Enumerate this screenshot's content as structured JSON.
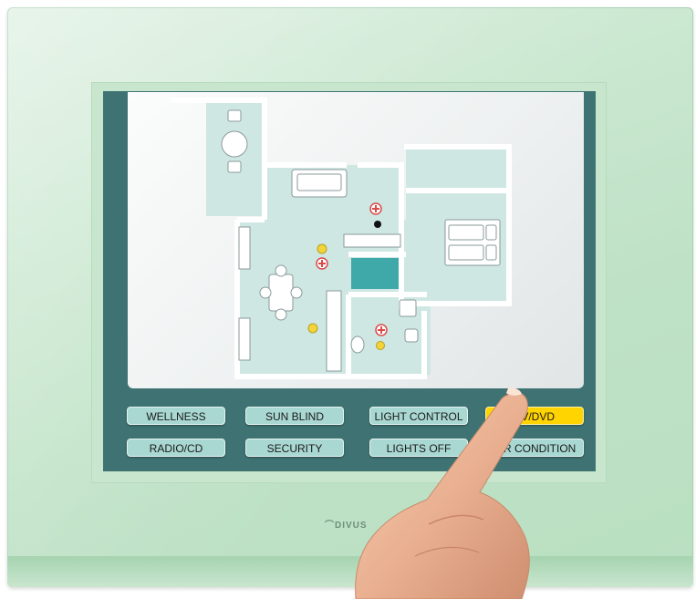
{
  "brand": {
    "logo_text": "DIVUS"
  },
  "controls": {
    "row1": [
      {
        "id": "wellness",
        "label": "WELLNESS",
        "active": false
      },
      {
        "id": "sun-blind",
        "label": "SUN BLIND",
        "active": false
      },
      {
        "id": "light-control",
        "label": "LIGHT CONTROL",
        "active": false
      },
      {
        "id": "tv-dvd",
        "label": "TV/DVD",
        "active": true
      }
    ],
    "row2": [
      {
        "id": "radio-cd",
        "label": "RADIO/CD",
        "active": false
      },
      {
        "id": "security",
        "label": "SECURITY",
        "active": false
      },
      {
        "id": "lights-off",
        "label": "LIGHTS OFF",
        "active": false
      },
      {
        "id": "air-condition",
        "label": "AIR CONDITION",
        "active": false
      }
    ]
  },
  "colors": {
    "frame": "#3f7373",
    "button": "#a9d8d2",
    "button_active": "#ffd400",
    "room_fill": "#cfe7e3",
    "wall": "#ffffff",
    "pool": "#3fa8a8",
    "light_indicator": "#f2d43a",
    "heating_indicator": "#d94a4a"
  },
  "floorplan": {
    "rooms": [
      "balcony",
      "living-room",
      "bedroom",
      "bathroom",
      "pool"
    ],
    "indicators": [
      {
        "type": "heating",
        "room": "hall"
      },
      {
        "type": "sensor",
        "room": "hall"
      },
      {
        "type": "light",
        "room": "living-room"
      },
      {
        "type": "heating",
        "room": "living-room"
      },
      {
        "type": "light",
        "room": "living-room"
      },
      {
        "type": "heating",
        "room": "bathroom"
      },
      {
        "type": "light",
        "room": "bathroom"
      }
    ]
  }
}
